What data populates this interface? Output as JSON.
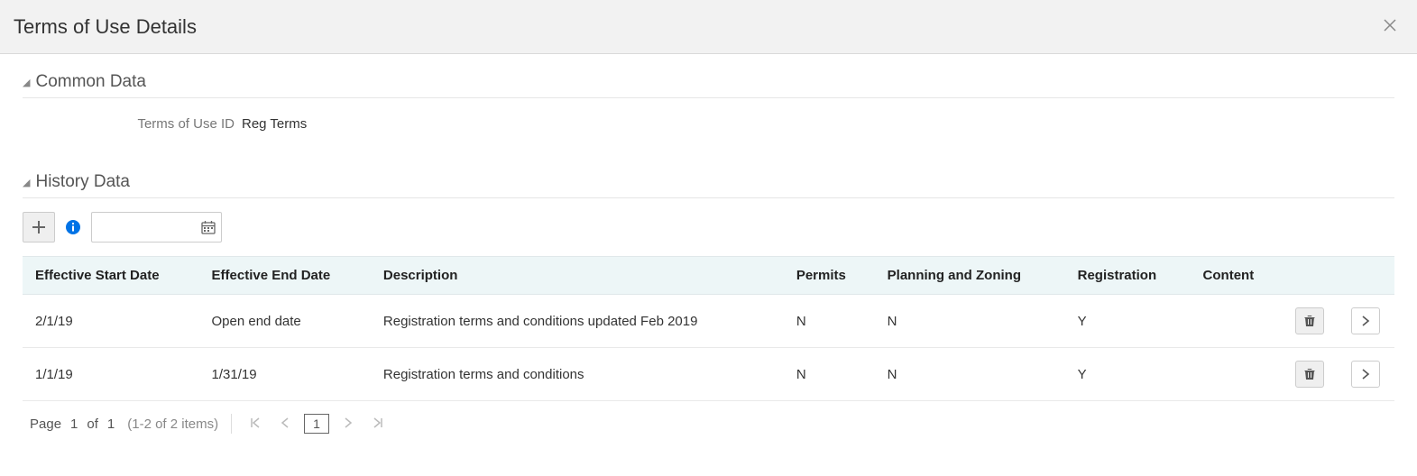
{
  "header": {
    "title": "Terms of Use Details"
  },
  "common": {
    "section_title": "Common Data",
    "terms_of_use_id_label": "Terms of Use ID",
    "terms_of_use_id_value": "Reg Terms"
  },
  "history": {
    "section_title": "History Data",
    "date_input_value": "",
    "columns": {
      "start": "Effective Start Date",
      "end": "Effective End Date",
      "desc": "Description",
      "permits": "Permits",
      "pz": "Planning and Zoning",
      "reg": "Registration",
      "content": "Content"
    },
    "rows": [
      {
        "start": "2/1/19",
        "end": "Open end date",
        "desc": "Registration terms and conditions updated Feb 2019",
        "permits": "N",
        "pz": "N",
        "reg": "Y",
        "content": ""
      },
      {
        "start": "1/1/19",
        "end": "1/31/19",
        "desc": "Registration terms and conditions",
        "permits": "N",
        "pz": "N",
        "reg": "Y",
        "content": ""
      }
    ]
  },
  "pagination": {
    "page_word": "Page",
    "current": "1",
    "of_word": "of",
    "total": "1",
    "range": "(1-2 of 2 items)",
    "page_input": "1"
  }
}
